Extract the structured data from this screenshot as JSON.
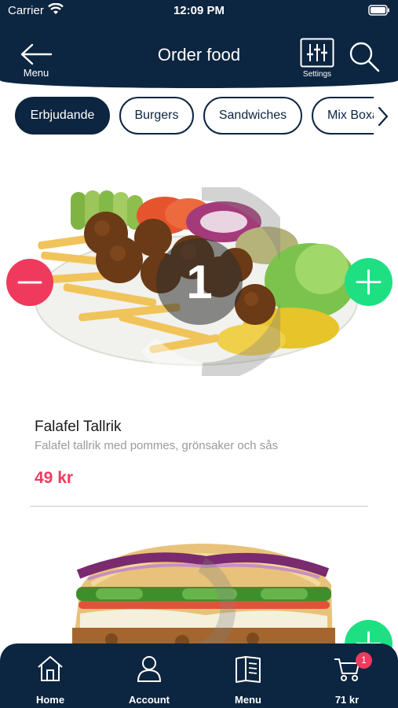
{
  "status_bar": {
    "carrier": "Carrier",
    "time": "12:09 PM"
  },
  "header": {
    "back_label": "Menu",
    "title": "Order food",
    "settings_label": "Settings"
  },
  "categories": [
    {
      "label": "Erbjudande",
      "active": true
    },
    {
      "label": "Burgers",
      "active": false
    },
    {
      "label": "Sandwiches",
      "active": false
    },
    {
      "label": "Mix Boxar",
      "active": false
    }
  ],
  "items": [
    {
      "name": "Falafel Tallrik",
      "description": "Falafel tallrik med pommes, grönsaker och sås",
      "price": "49 kr",
      "quantity": "1"
    }
  ],
  "tabbar": {
    "home": "Home",
    "account": "Account",
    "menu": "Menu",
    "cart_total": "71 kr",
    "cart_count": "1"
  },
  "colors": {
    "primary": "#0c2540",
    "accent_red": "#ef3a5d",
    "accent_green": "#1ee082"
  }
}
